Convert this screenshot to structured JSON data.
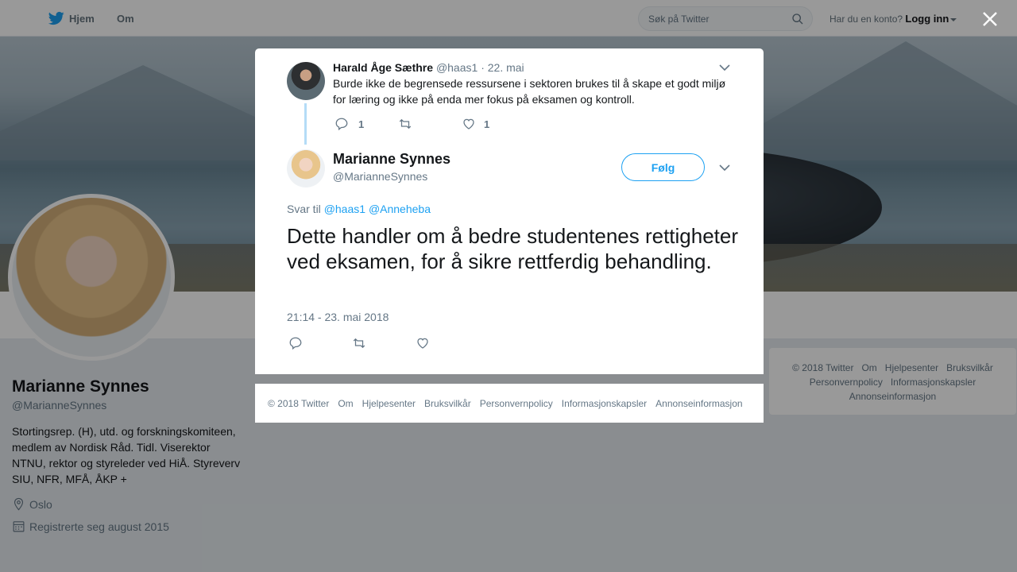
{
  "nav": {
    "home_label": "Hjem",
    "about_label": "Om",
    "search_placeholder": "Søk på Twitter",
    "account_prompt": "Har du en konto?",
    "login_label": "Logg inn"
  },
  "profile": {
    "name": "Marianne Synnes",
    "handle": "@MarianneSynnes",
    "bio": "Stortingsrep. (H), utd. og forskningskomiteen, medlem av Nordisk Råd. Tidl. Viserektor NTNU, rektor og styreleder ved HiÅ. Styreverv SIU, NFR, MFÅ, ÅKP +",
    "location": "Oslo",
    "joined": "Registrerte seg august 2015"
  },
  "right_footer": {
    "links": [
      "© 2018 Twitter",
      "Om",
      "Hjelpesenter",
      "Bruksvilkår",
      "Personvernpolicy",
      "Informasjonskapsler",
      "Annonseinformasjon"
    ]
  },
  "parent_tweet": {
    "author_name": "Harald Åge Sæthre",
    "author_handle": "@haas1",
    "date": "22. mai",
    "text": "Burde ikke de begrensede ressursene i sektoren brukes til å skape et godt miljø for læring og ikke på enda mer fokus på eksamen og kontroll.",
    "reply_count": "1",
    "like_count": "1"
  },
  "main_tweet": {
    "author_name": "Marianne Synnes",
    "author_handle": "@MarianneSynnes",
    "follow_label": "Følg",
    "reply_prefix": "Svar til",
    "reply_to_1": "@haas1",
    "reply_to_2": "@Anneheba",
    "text": "Dette handler om å bedre studentenes rettigheter ved eksamen, for å sikre rettferdig behandling.",
    "timestamp": "21:14 - 23. mai 2018"
  },
  "modal_footer": {
    "links": [
      "© 2018 Twitter",
      "Om",
      "Hjelpesenter",
      "Bruksvilkår",
      "Personvernpolicy",
      "Informasjonskapsler",
      "Annonseinformasjon"
    ]
  },
  "colors": {
    "accent": "#1da1f2",
    "secondary_text": "#657786",
    "thread_line": "#b4dcf7"
  },
  "icons": [
    "twitter-bird-icon",
    "search-icon",
    "close-icon",
    "chevron-down-icon",
    "reply-icon",
    "retweet-icon",
    "heart-icon",
    "location-icon",
    "calendar-icon"
  ]
}
